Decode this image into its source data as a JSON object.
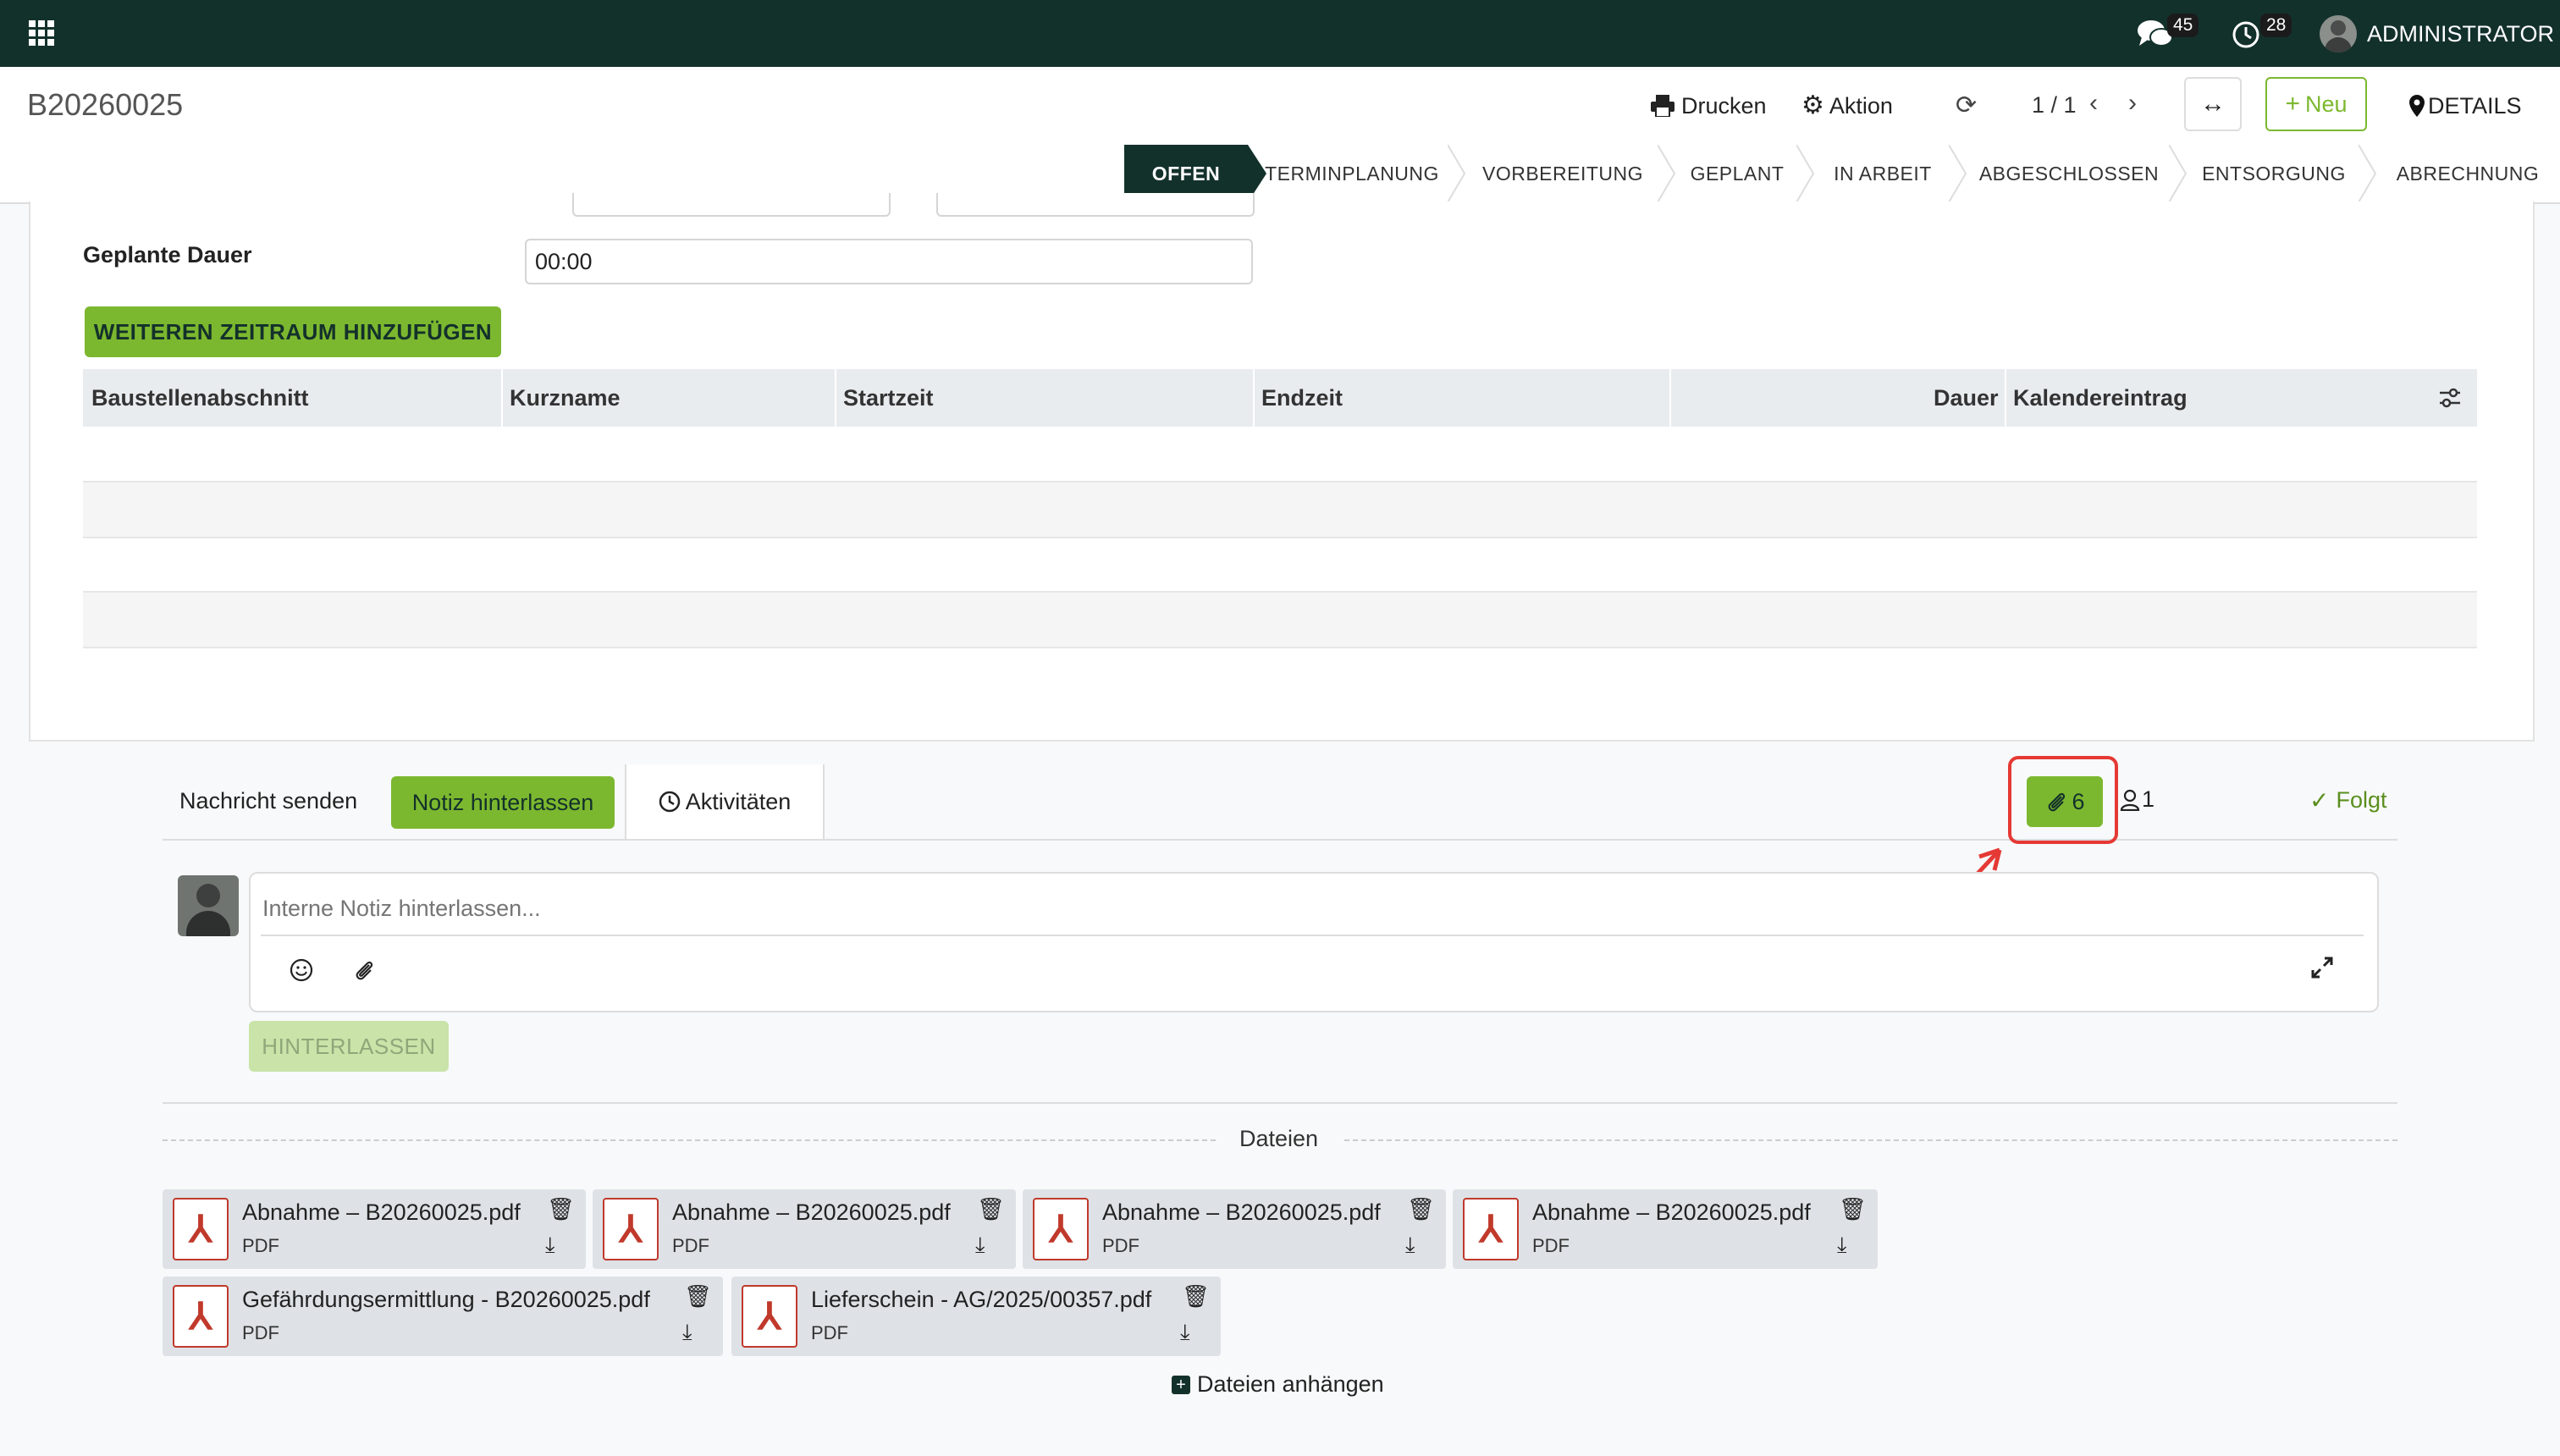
{
  "navbar": {
    "messages_count": "45",
    "activities_count": "28",
    "user_name": "ADMINISTRATOR"
  },
  "control_panel": {
    "record_title": "B20260025",
    "print_label": "Drucken",
    "action_label": "Aktion",
    "pager": "1 / 1",
    "new_label": "Neu",
    "details_label": "DETAILS"
  },
  "stages": [
    "OFFEN",
    "TERMINPLANUNG",
    "VORBEREITUNG",
    "GEPLANT",
    "IN ARBEIT",
    "ABGESCHLOSSEN",
    "ENTSORGUNG",
    "ABRECHNUNG"
  ],
  "form": {
    "duration_label": "Geplante Dauer",
    "duration_value": "00:00",
    "add_period_button": "WEITEREN ZEITRAUM HINZUFÜGEN",
    "table_headers": [
      "Baustellenabschnitt",
      "Kurzname",
      "Startzeit",
      "Endzeit",
      "Dauer",
      "Kalendereintrag"
    ]
  },
  "chatter": {
    "send_message": "Nachricht senden",
    "log_note": "Notiz hinterlassen",
    "activities": "Aktivitäten",
    "attachment_count": "6",
    "follower_count": "1",
    "follow_label": "Folgt",
    "note_placeholder": "Interne Notiz hinterlassen...",
    "submit_label": "HINTERLASSEN",
    "files_title": "Dateien",
    "attach_files_label": "Dateien anhängen",
    "attachments": [
      {
        "name": "Abnahme – B20260025.pdf",
        "type": "PDF"
      },
      {
        "name": "Abnahme – B20260025.pdf",
        "type": "PDF"
      },
      {
        "name": "Abnahme – B20260025.pdf",
        "type": "PDF"
      },
      {
        "name": "Abnahme – B20260025.pdf",
        "type": "PDF"
      },
      {
        "name": "Gefährdungsermittlung - B20260025.pdf",
        "type": "PDF"
      },
      {
        "name": "Lieferschein - AG/2025/00357.pdf",
        "type": "PDF"
      }
    ]
  },
  "colors": {
    "brand_dark": "#13312b",
    "accent_green": "#7cb82f",
    "highlight_red": "#e53935"
  }
}
